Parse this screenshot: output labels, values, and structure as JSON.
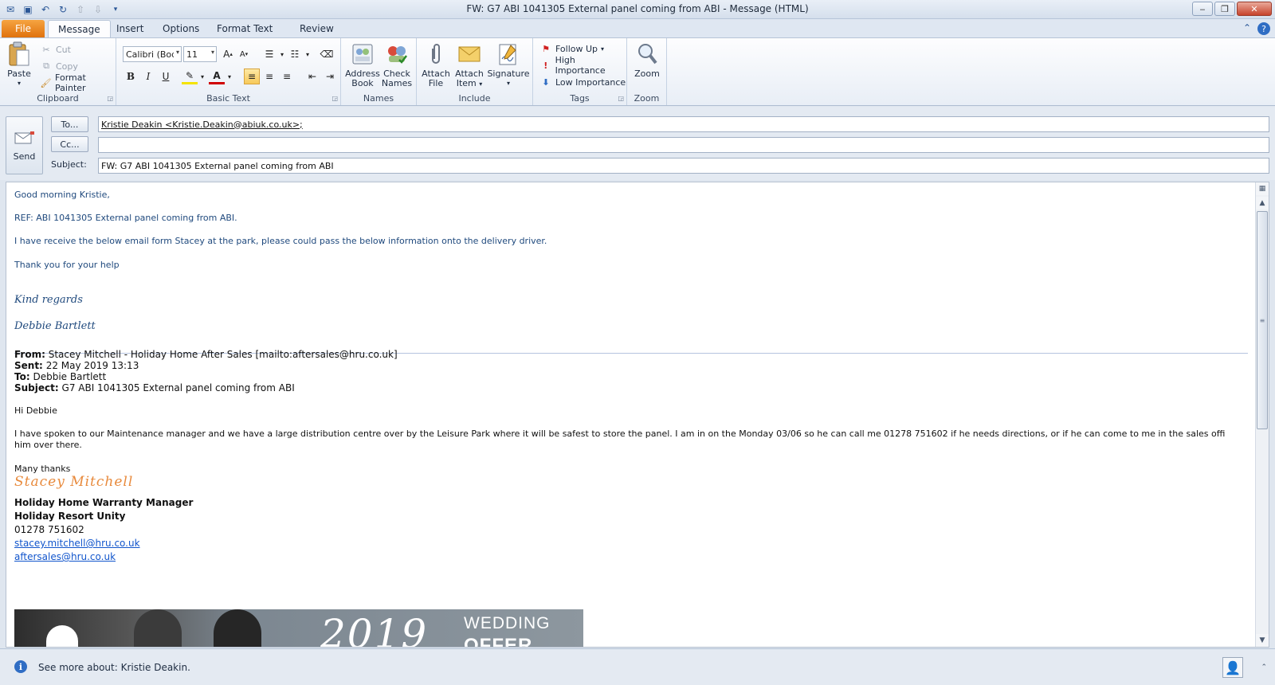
{
  "window": {
    "title": "FW: G7 ABI 1041305 External panel coming from ABI  -  Message (HTML)"
  },
  "tabs": [
    {
      "label": "File"
    },
    {
      "label": "Message"
    },
    {
      "label": "Insert"
    },
    {
      "label": "Options"
    },
    {
      "label": "Format Text"
    },
    {
      "label": "Review"
    }
  ],
  "ribbon": {
    "clipboard": {
      "label": "Clipboard",
      "paste": "Paste",
      "cut": "Cut",
      "copy": "Copy",
      "format_painter": "Format Painter"
    },
    "basic_text": {
      "label": "Basic Text",
      "font": "Calibri (Body)",
      "size": "11"
    },
    "names": {
      "label": "Names",
      "address_book_1": "Address",
      "address_book_2": "Book",
      "check_names_1": "Check",
      "check_names_2": "Names"
    },
    "include": {
      "label": "Include",
      "attach_file_1": "Attach",
      "attach_file_2": "File",
      "attach_item_1": "Attach",
      "attach_item_2": "Item",
      "signature": "Signature"
    },
    "tags": {
      "label": "Tags",
      "follow_up": "Follow Up",
      "high_importance": "High Importance",
      "low_importance": "Low Importance"
    },
    "zoom": {
      "label": "Zoom",
      "zoom": "Zoom"
    }
  },
  "header": {
    "send": "Send",
    "to_button": "To...",
    "cc_button": "Cc...",
    "subject_label": "Subject:",
    "to_value": "Kristie Deakin <Kristie.Deakin@abiuk.co.uk>;",
    "cc_value": "",
    "subject_value": "FW: G7 ABI 1041305 External panel coming from ABI"
  },
  "body": {
    "greeting": "Good morning Kristie,",
    "ref": "REF: ABI 1041305 External panel coming from ABI.",
    "line1": "I have receive the below email form Stacey at the park, please could pass the below information onto the delivery driver.",
    "thanks": "Thank you for your help",
    "regards": "Kind regards",
    "sender_name": "Debbie Bartlett",
    "fwd": {
      "from_label": "From:",
      "from_value": "Stacey Mitchell - Holiday Home After Sales [mailto:aftersales@hru.co.uk]",
      "sent_label": "Sent:",
      "sent_value": "22 May 2019 13:13",
      "to_label": "To:",
      "to_value": "Debbie Bartlett",
      "subject_label": "Subject:",
      "subject_value": "G7 ABI 1041305 External panel coming from ABI"
    },
    "hi": "Hi Debbie",
    "message_line1": "I have spoken to our Maintenance manager and we have a large distribution centre over by the Leisure Park where it will be safest to store the panel. I am in on the Monday 03/06 so he can call me 01278 751602 if he needs directions, or if he can come to me in the sales office first I can take",
    "message_line2": "him over there.",
    "many_thanks": "Many thanks",
    "sig_script": "Stacey Mitchell",
    "sig_title": "Holiday Home Warranty Manager",
    "sig_company": "Holiday Resort Unity",
    "sig_phone": "01278 751602",
    "sig_email1": "stacey.mitchell@hru.co.uk",
    "sig_email2": "aftersales@hru.co.uk",
    "banner_year": "2019",
    "banner_wedding": "WEDDING",
    "banner_offer": "OFFER"
  },
  "status": {
    "message": "See more about: Kristie Deakin."
  },
  "colors": {
    "accent": "#1f497d",
    "file_tab": "#e0720d",
    "link": "#1155cc",
    "signature": "#e88a3c"
  }
}
